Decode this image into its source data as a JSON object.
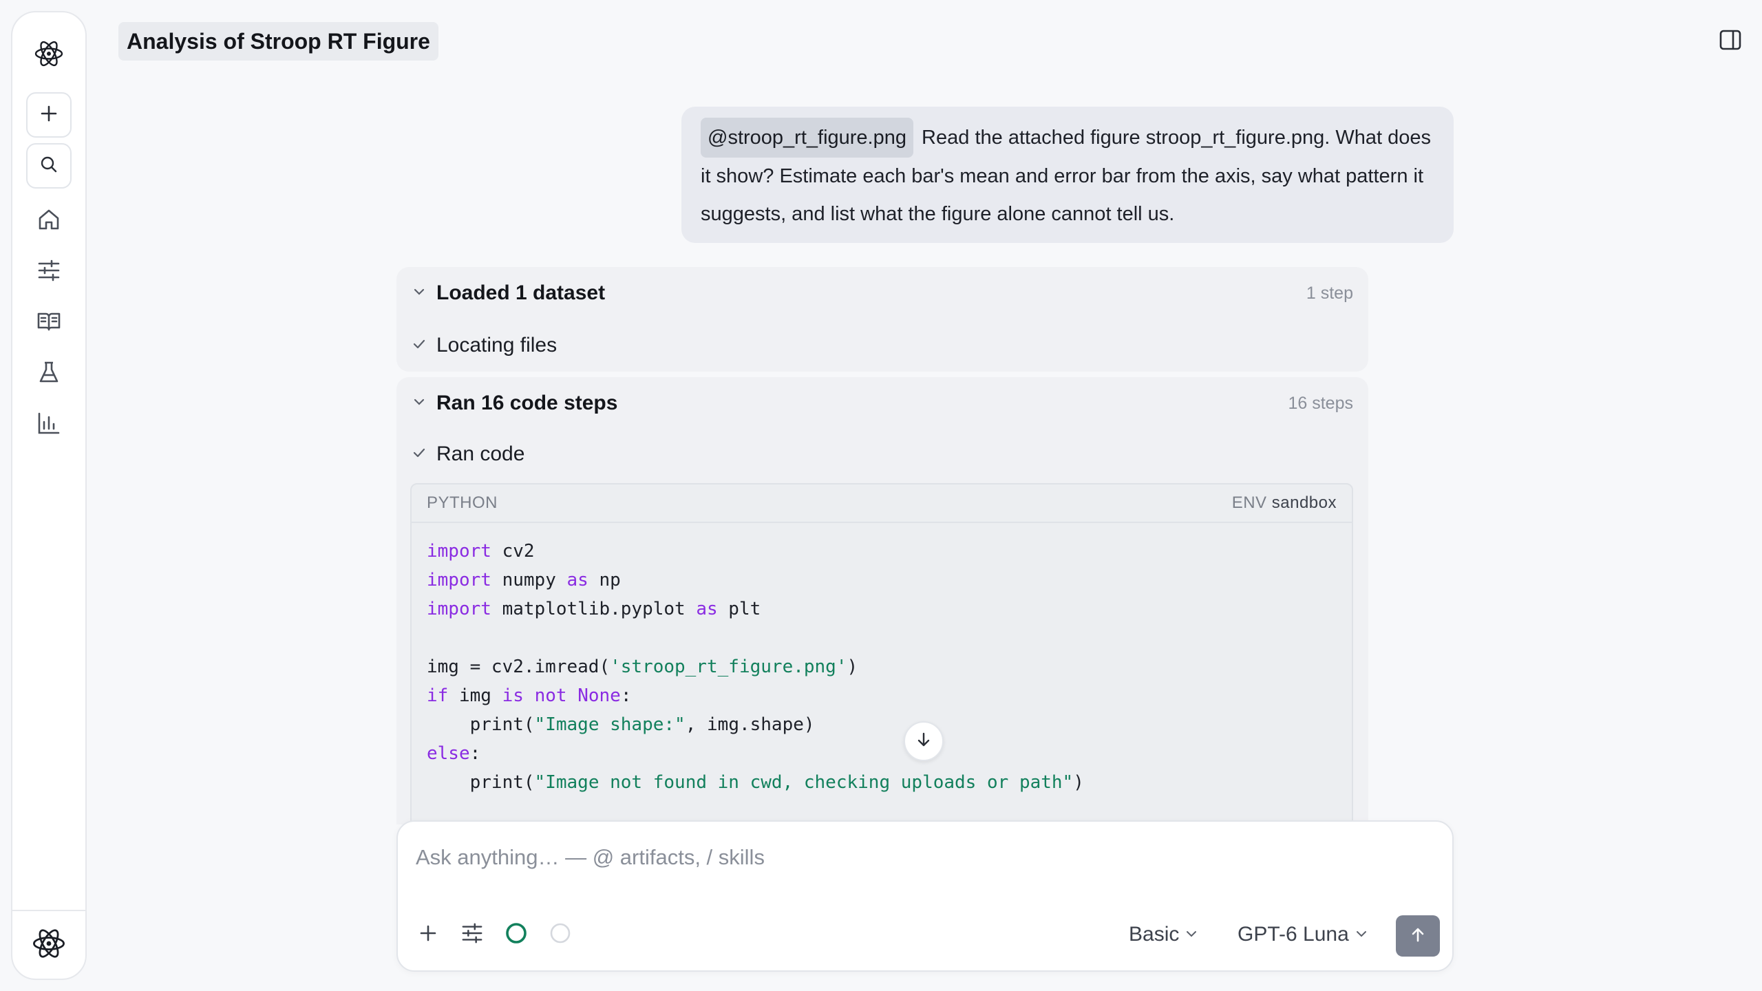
{
  "app": {
    "title": "Analysis of Stroop RT Figure"
  },
  "sidebar": {
    "logo_icon": "atom-icon",
    "new_icon": "plus-icon",
    "search_icon": "search-icon",
    "nav": [
      {
        "icon": "home-icon"
      },
      {
        "icon": "sliders-icon"
      },
      {
        "icon": "book-icon"
      },
      {
        "icon": "flask-icon"
      },
      {
        "icon": "bar-chart-icon"
      }
    ],
    "bottom_icon": "atom-icon"
  },
  "user_message": {
    "mention": "@stroop_rt_figure.png",
    "text": " Read the attached figure stroop_rt_figure.png. What does it show? Estimate each bar's mean and error bar from the axis, say what pattern it suggests, and list what the figure alone cannot tell us."
  },
  "steps": [
    {
      "title": "Loaded 1 dataset",
      "count": "1 step",
      "items": [
        {
          "label": "Locating files"
        }
      ]
    },
    {
      "title": "Ran 16 code steps",
      "count": "16 steps",
      "items": [
        {
          "label": "Ran code"
        }
      ]
    }
  ],
  "code_block": {
    "language": "PYTHON",
    "env_label": "ENV",
    "env_value": "sandbox",
    "lines": [
      "import cv2",
      "import numpy as np",
      "import matplotlib.pyplot as plt",
      "",
      "img = cv2.imread('stroop_rt_figure.png')",
      "if img is not None:",
      "    print(\"Image shape:\", img.shape)",
      "else:",
      "    print(\"Image not found in cwd, checking uploads or path\")"
    ]
  },
  "composer": {
    "placeholder": "Ask anything… — @ artifacts, / skills",
    "mode": "Basic",
    "model": "GPT-6 Luna"
  },
  "colors": {
    "accent_green": "#12805c",
    "keyword_purple": "#8a2be2",
    "send_button": "#7b8190"
  }
}
